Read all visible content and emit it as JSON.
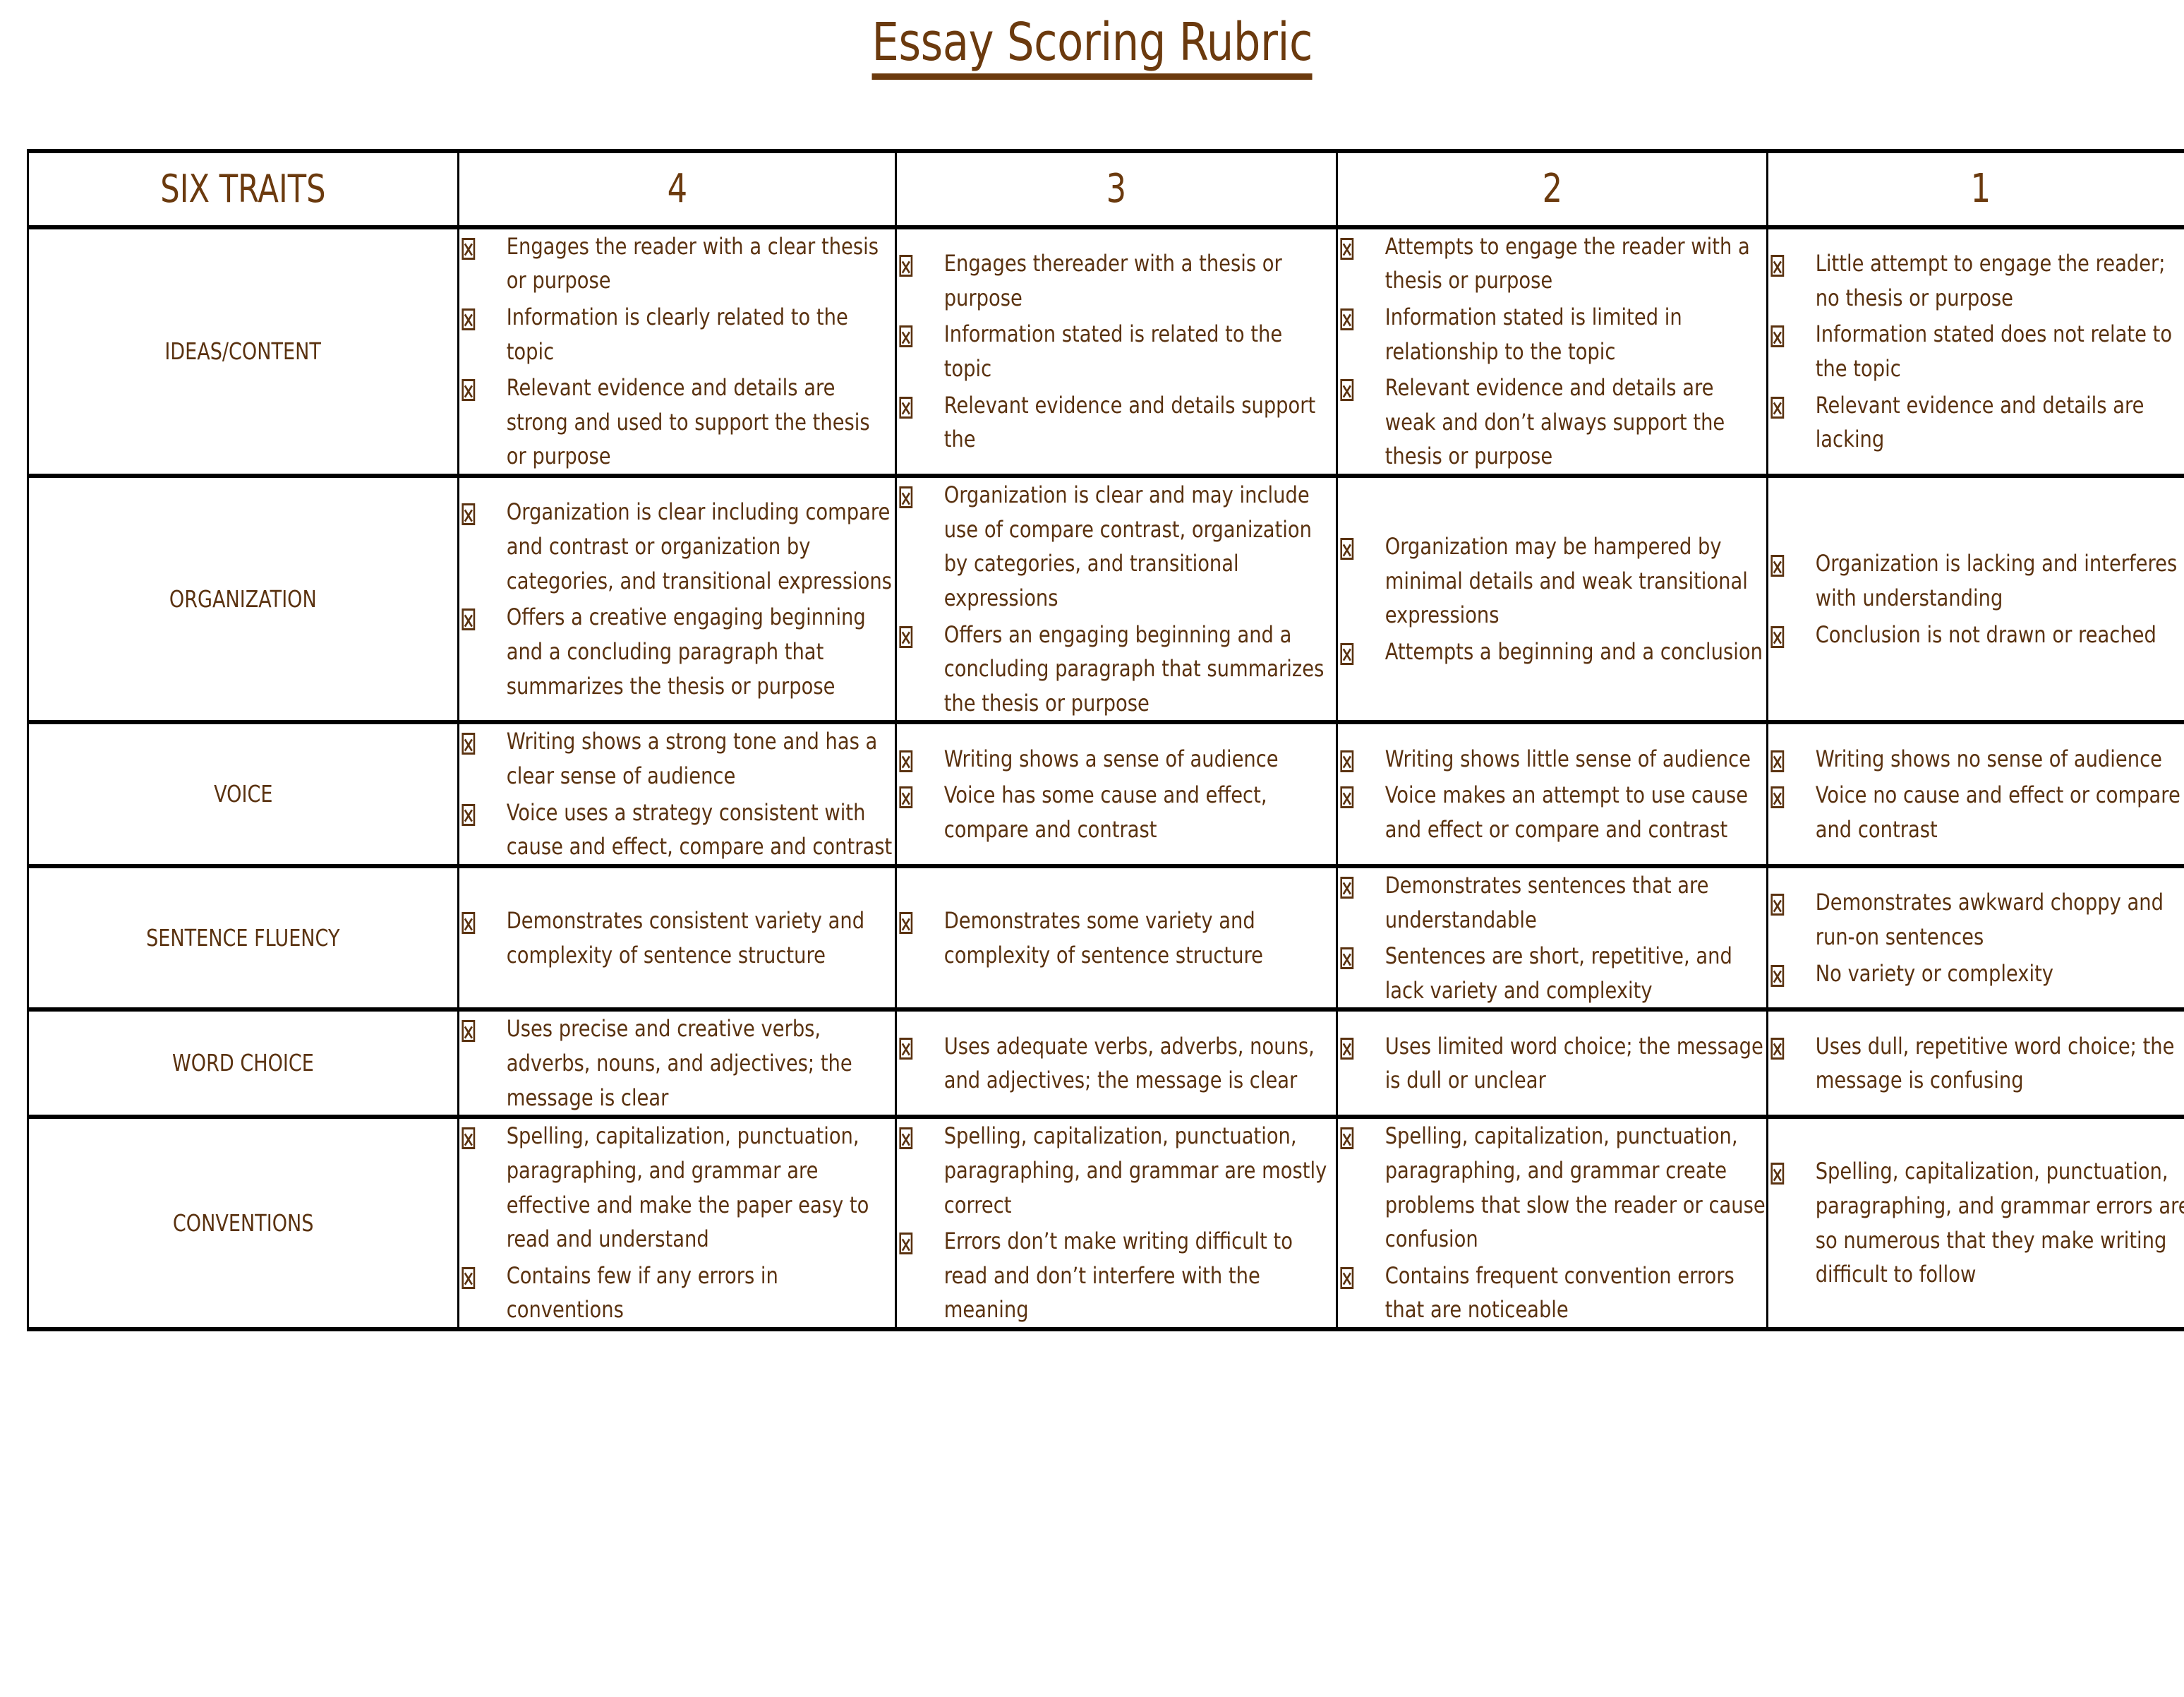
{
  "document": {
    "title": "Essay Scoring Rubric",
    "accent_color": "#6B3A0E",
    "text_color": "#5A3210",
    "border_color": "#000000",
    "background_color": "#FFFFFF",
    "bullet_glyph": "missing-glyph-box"
  },
  "table": {
    "columns": [
      {
        "key": "trait",
        "label": "SIX TRAITS"
      },
      {
        "key": "score4",
        "label": "4"
      },
      {
        "key": "score3",
        "label": "3"
      },
      {
        "key": "score2",
        "label": "2"
      },
      {
        "key": "score1",
        "label": "1"
      }
    ],
    "rows": [
      {
        "trait": "IDEAS/CONTENT",
        "score4": [
          "Engages the reader with a clear thesis or purpose",
          "Information is clearly related to the topic",
          "Relevant evidence and details are strong and used to support the thesis or purpose"
        ],
        "score3": [
          "Engages thereader with a thesis or purpose",
          "Information stated is related to the topic",
          "Relevant evidence and details support the"
        ],
        "score2": [
          "Attempts to engage the reader with a thesis or purpose",
          "Information stated is limited in relationship to the topic",
          "Relevant evidence and details are weak and don’t always support the thesis or purpose"
        ],
        "score1": [
          "Little attempt to engage the reader; no thesis or purpose",
          "Information stated does not relate to the topic",
          "Relevant evidence and details are lacking"
        ]
      },
      {
        "trait": "ORGANIZATION",
        "score4": [
          "Organization is clear including compare and contrast or organization by categories, and transitional expressions",
          "Offers a creative engaging beginning and a concluding paragraph that summarizes the thesis or purpose"
        ],
        "score3": [
          "Organization is clear and may include use of compare contrast, organization by categories, and transitional expressions",
          "Offers an engaging beginning and a concluding paragraph that summarizes the thesis or purpose"
        ],
        "score2": [
          "Organization may be hampered by minimal details and weak transitional expressions",
          "Attempts a beginning and a conclusion"
        ],
        "score1": [
          "Organization is lacking and interferes with understanding",
          "Conclusion is not drawn or reached"
        ]
      },
      {
        "trait": "VOICE",
        "score4": [
          "Writing shows a strong tone and has a clear sense of audience",
          "Voice uses a strategy consistent with cause and effect, compare and contrast"
        ],
        "score3": [
          "Writing shows a sense of audience",
          "Voice has some cause and effect, compare and contrast"
        ],
        "score2": [
          "Writing shows little sense of audience",
          "Voice makes an attempt to use cause and effect or compare and contrast"
        ],
        "score1": [
          "Writing shows no sense of audience",
          "Voice no cause and effect or compare and contrast"
        ]
      },
      {
        "trait": "SENTENCE FLUENCY",
        "score4": [
          "Demonstrates consistent variety and complexity of sentence structure"
        ],
        "score3": [
          "Demonstrates some variety and complexity of sentence structure"
        ],
        "score2": [
          "Demonstrates sentences that are understandable",
          "Sentences are short, repetitive, and lack variety and complexity"
        ],
        "score1": [
          "Demonstrates awkward choppy and run-on sentences",
          "No variety or complexity"
        ]
      },
      {
        "trait": "WORD CHOICE",
        "score4": [
          "Uses precise and creative verbs, adverbs, nouns, and adjectives; the message is clear"
        ],
        "score3": [
          "Uses adequate verbs, adverbs, nouns, and adjectives; the message is clear"
        ],
        "score2": [
          "Uses limited word choice; the message is dull or unclear"
        ],
        "score1": [
          "Uses dull, repetitive word choice; the message is confusing"
        ]
      },
      {
        "trait": "CONVENTIONS",
        "score4": [
          "Spelling, capitalization, punctuation, paragraphing, and grammar are effective and make the paper easy to read and understand",
          "Contains few if any errors in conventions"
        ],
        "score3": [
          "Spelling, capitalization, punctuation, paragraphing, and grammar are mostly correct",
          "Errors don’t make writing difficult to read and don’t interfere with the meaning"
        ],
        "score2": [
          "Spelling, capitalization, punctuation, paragraphing, and grammar create problems that slow the reader or cause confusion",
          "Contains frequent convention errors that are noticeable"
        ],
        "score1": [
          "Spelling, capitalization, punctuation, paragraphing, and grammar errors are so numerous that they make writing difficult to follow"
        ]
      }
    ]
  }
}
